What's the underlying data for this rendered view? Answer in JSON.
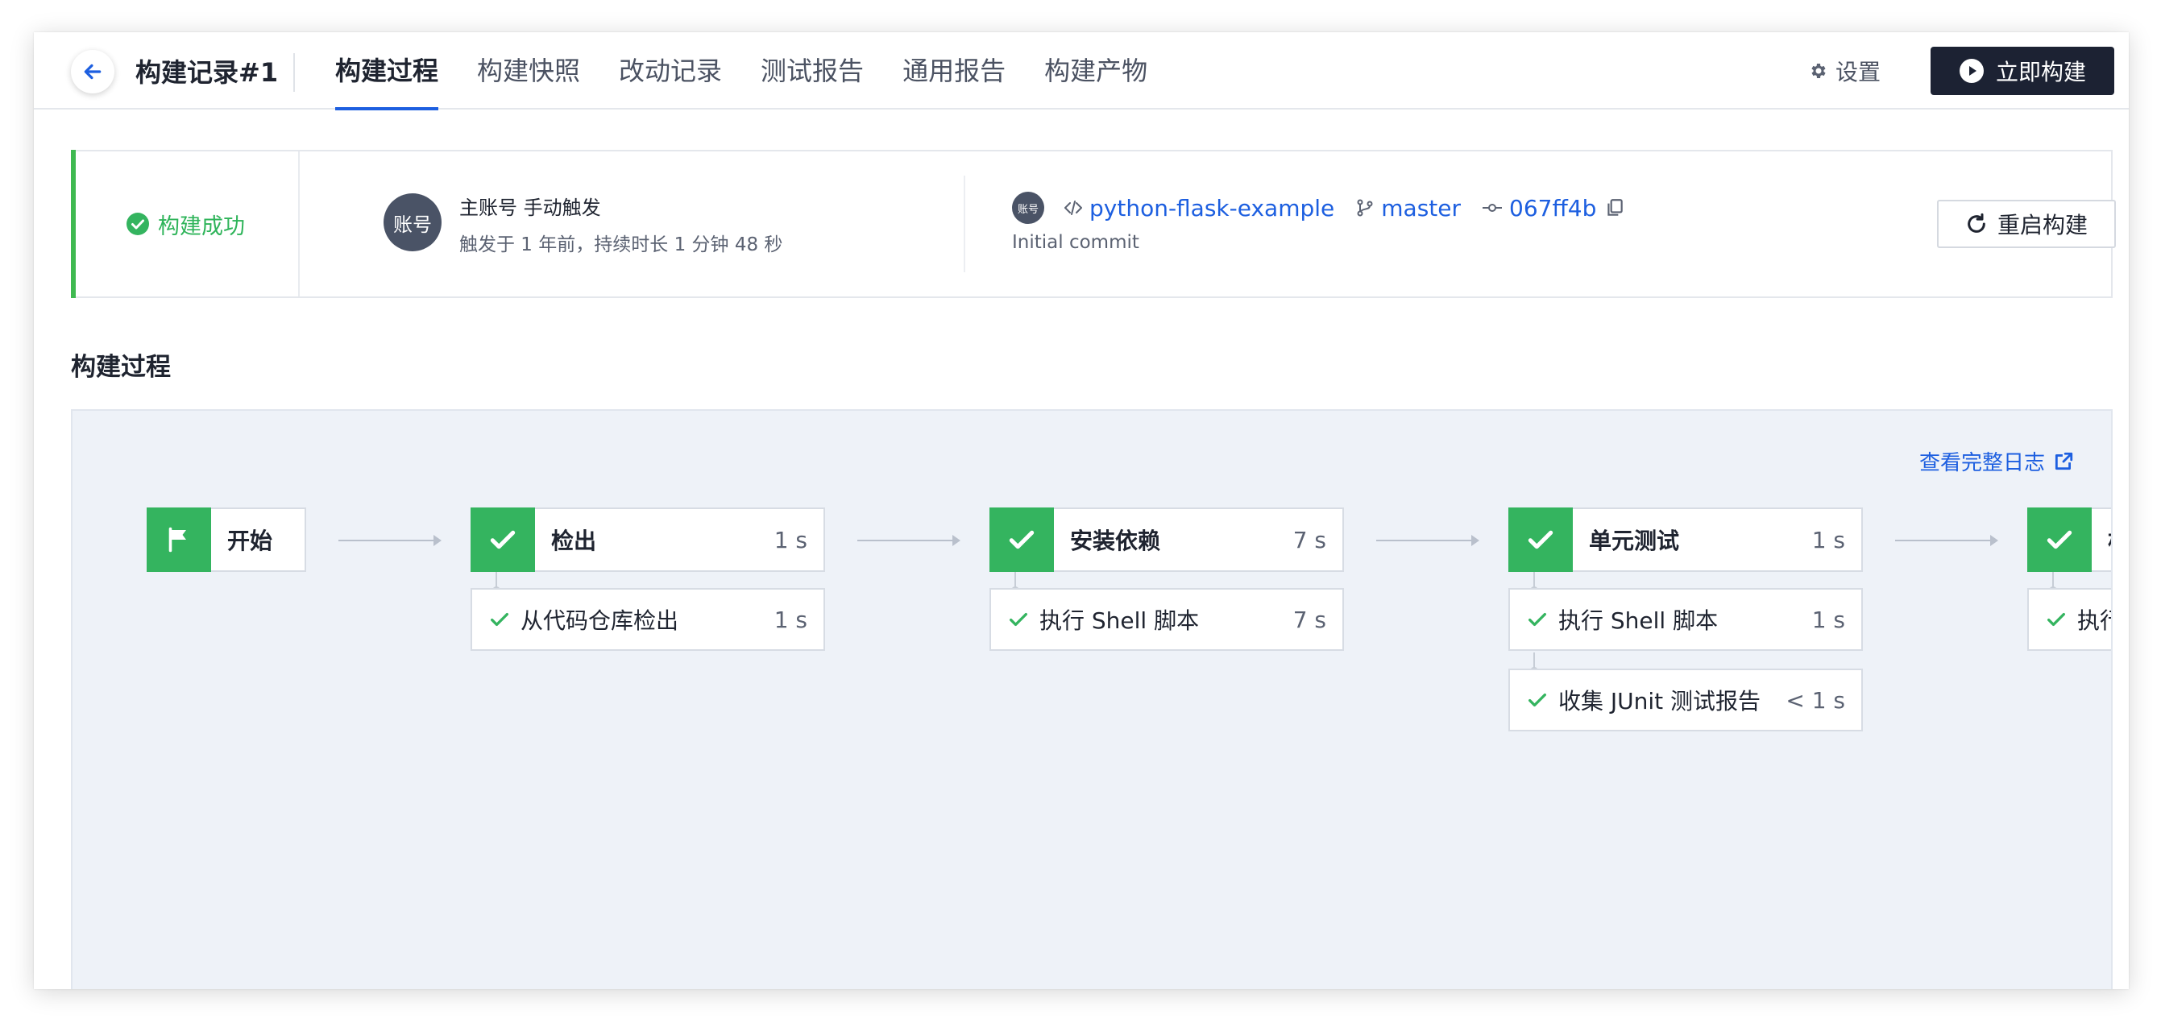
{
  "header": {
    "title": "构建记录#1",
    "tabs": [
      {
        "label": "构建过程",
        "active": true
      },
      {
        "label": "构建快照"
      },
      {
        "label": "改动记录"
      },
      {
        "label": "测试报告"
      },
      {
        "label": "通用报告"
      },
      {
        "label": "构建产物"
      }
    ],
    "settings_label": "设置",
    "build_now_label": "立即构建"
  },
  "summary": {
    "status": "构建成功",
    "avatar_text": "账号",
    "trigger_line": "主账号 手动触发",
    "time_line": "触发于 1 年前，持续时长 1 分钟 48 秒",
    "small_avatar_text": "账号",
    "repo": "python-flask-example",
    "branch": "master",
    "commit": "067ff4b",
    "commit_message": "Initial commit",
    "restart_label": "重启构建"
  },
  "section_title": "构建过程",
  "pipeline": {
    "view_log_label": "查看完整日志",
    "start_label": "开始",
    "stages": [
      {
        "name": "检出",
        "duration": "1 s",
        "steps": [
          {
            "name": "从代码仓库检出",
            "duration": "1 s"
          }
        ]
      },
      {
        "name": "安装依赖",
        "duration": "7 s",
        "steps": [
          {
            "name": "执行 Shell 脚本",
            "duration": "7 s"
          }
        ]
      },
      {
        "name": "单元测试",
        "duration": "1 s",
        "steps": [
          {
            "name": "执行 Shell 脚本",
            "duration": "1 s"
          },
          {
            "name": "收集 JUnit 测试报告",
            "duration": "< 1 s"
          }
        ]
      },
      {
        "name": "构",
        "duration": "",
        "steps": [
          {
            "name": "执行",
            "duration": ""
          }
        ]
      }
    ]
  },
  "colors": {
    "accent_blue": "#1d5fe0",
    "success_green": "#34b45f",
    "dark_button": "#1c2233",
    "canvas_bg": "#eef2f8"
  },
  "icons": {
    "back": "arrow-left-icon",
    "settings": "gear-icon",
    "play": "play-circle-icon",
    "success": "check-circle-icon",
    "code": "code-icon",
    "branch": "git-branch-icon",
    "commit": "git-commit-icon",
    "copy": "copy-icon",
    "restart": "refresh-icon",
    "external": "external-link-icon",
    "flag": "flag-icon",
    "check": "check-icon"
  }
}
